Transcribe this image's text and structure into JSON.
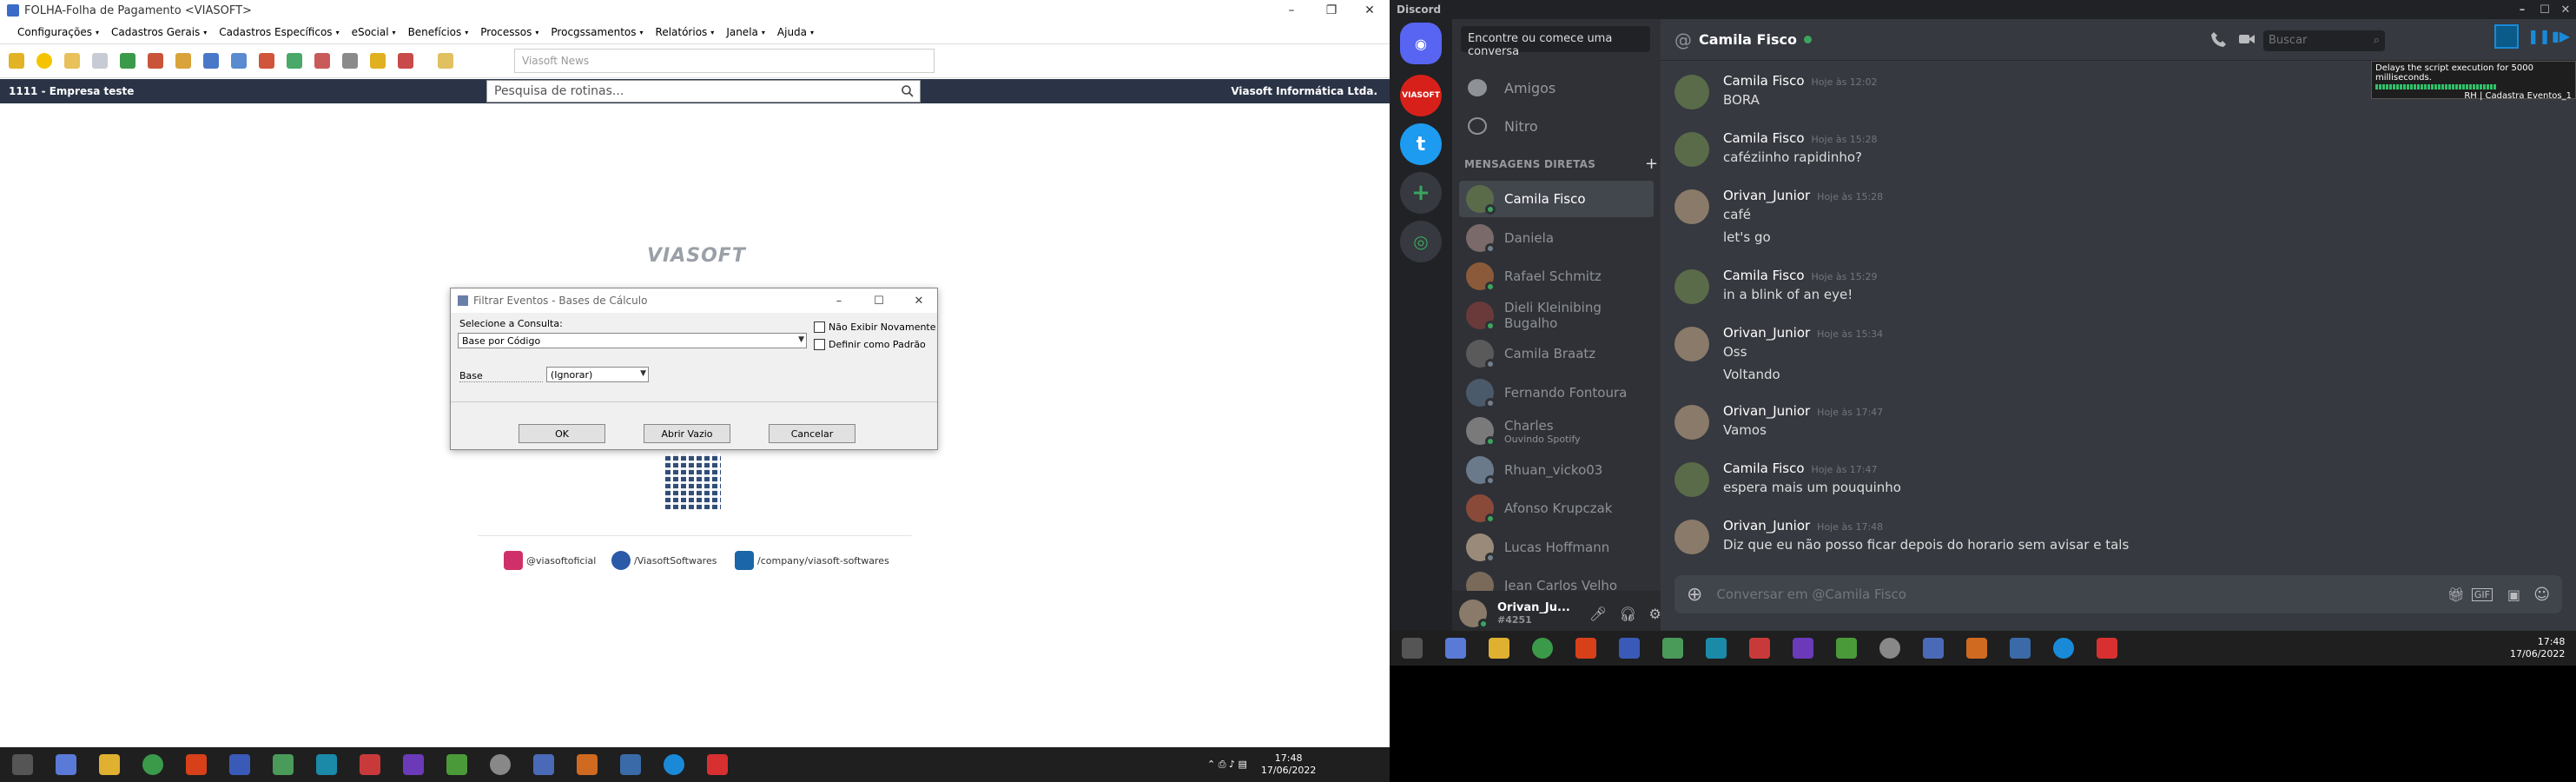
{
  "left_app": {
    "title": "FOLHA-Folha de Pagamento <VIASOFT>",
    "menu": [
      "Configurações",
      "Cadastros Gerais",
      "Cadastros Específicos",
      "eSocial",
      "Benefícios",
      "Processos",
      "Procgssamentos",
      "Relatórios",
      "Janela",
      "Ajuda"
    ],
    "news": "Viasoft News",
    "company": "1111 - Empresa teste",
    "search_placeholder": "Pesquisa de rotinas...",
    "vendor": "Viasoft Informática Ltda.",
    "logo": "VIASOFT",
    "dialog": {
      "title": "Filtrar Eventos - Bases de Cálculo",
      "select_label": "Selecione a Consulta:",
      "select_value": "Base por Código",
      "chk_nao_exibir": "Não Exibir Novamente",
      "chk_padrao": "Definir como Padrão",
      "base_label": "Base",
      "base_value": "(Ignorar)",
      "ok": "OK",
      "abrir": "Abrir Vazio",
      "cancel": "Cancelar"
    },
    "social": {
      "instagram": "@viasoftoficial",
      "facebook": "/ViasoftSoftwares",
      "linkedin": "/company/viasoft-softwares"
    },
    "clock_time": "17:48",
    "clock_date": "17/06/2022"
  },
  "discord": {
    "app_title": "Discord",
    "find_placeholder": "Encontre ou comece uma conversa",
    "nav_friends": "Amigos",
    "nav_nitro": "Nitro",
    "dm_header": "MENSAGENS DIRETAS",
    "dms": [
      {
        "name": "Camila Fisco",
        "sub": "",
        "status": "#3ba55d",
        "color": "#5a6b4a"
      },
      {
        "name": "Daniela",
        "sub": "",
        "status": "#747f8d",
        "color": "#7a6a6a"
      },
      {
        "name": "Rafael Schmitz",
        "sub": "",
        "status": "#3ba55d",
        "color": "#8a5a3a"
      },
      {
        "name": "Dieli Kleinibing Bugalho",
        "sub": "",
        "status": "#3ba55d",
        "color": "#6a3a3a"
      },
      {
        "name": "Camila Braatz",
        "sub": "",
        "status": "#747f8d",
        "color": "#5a5a5a"
      },
      {
        "name": "Fernando Fontoura",
        "sub": "",
        "status": "#747f8d",
        "color": "#4a5a6a"
      },
      {
        "name": "Charles",
        "sub": "Ouvindo Spotify",
        "status": "#3ba55d",
        "color": "#7a7a7a"
      },
      {
        "name": "Rhuan_vicko03",
        "sub": "",
        "status": "#747f8d",
        "color": "#6a7a8a"
      },
      {
        "name": "Afonso Krupczak",
        "sub": "",
        "status": "#3ba55d",
        "color": "#8a4a3a"
      },
      {
        "name": "Lucas Hoffmann",
        "sub": "",
        "status": "#747f8d",
        "color": "#9a8a7a"
      },
      {
        "name": "Jean Carlos Velho",
        "sub": "",
        "status": "#747f8d",
        "color": "#7a6a5a"
      }
    ],
    "user_name": "Orivan_Ju...",
    "user_tag": "#4251",
    "chat_name": "Camila Fisco",
    "search_placeholder": "Buscar",
    "tooltip_line1": "Delays the script execution for 5000 milliseconds.",
    "tooltip_line2": "RH | Cadastra Eventos_1",
    "messages": [
      {
        "author": "Camila Fisco",
        "time": "Hoje às 12:02",
        "lines": [
          "BORA"
        ],
        "color": "#5a6b4a"
      },
      {
        "author": "Camila Fisco",
        "time": "Hoje às 15:28",
        "lines": [
          "caféziinho rapidinho?"
        ],
        "color": "#5a6b4a"
      },
      {
        "author": "Orivan_Junior",
        "time": "Hoje às 15:28",
        "lines": [
          "café",
          "let's go"
        ],
        "color": "#8a7a6a"
      },
      {
        "author": "Camila Fisco",
        "time": "Hoje às 15:29",
        "lines": [
          "in a blink  of an eye!"
        ],
        "color": "#5a6b4a"
      },
      {
        "author": "Orivan_Junior",
        "time": "Hoje às 15:34",
        "lines": [
          "Oss",
          "Voltando"
        ],
        "color": "#8a7a6a"
      },
      {
        "author": "Orivan_Junior",
        "time": "Hoje às 17:47",
        "lines": [
          "Vamos"
        ],
        "color": "#8a7a6a"
      },
      {
        "author": "Camila Fisco",
        "time": "Hoje às 17:47",
        "lines": [
          "espera mais um pouquinho"
        ],
        "color": "#5a6b4a"
      },
      {
        "author": "Orivan_Junior",
        "time": "Hoje às 17:48",
        "lines": [
          "Diz que eu não posso ficar depois do horario sem avisar e tals"
        ],
        "color": "#8a7a6a"
      }
    ],
    "input_placeholder": "Conversar em @Camila Fisco",
    "clock_time": "17:48",
    "clock_date": "17/06/2022"
  }
}
